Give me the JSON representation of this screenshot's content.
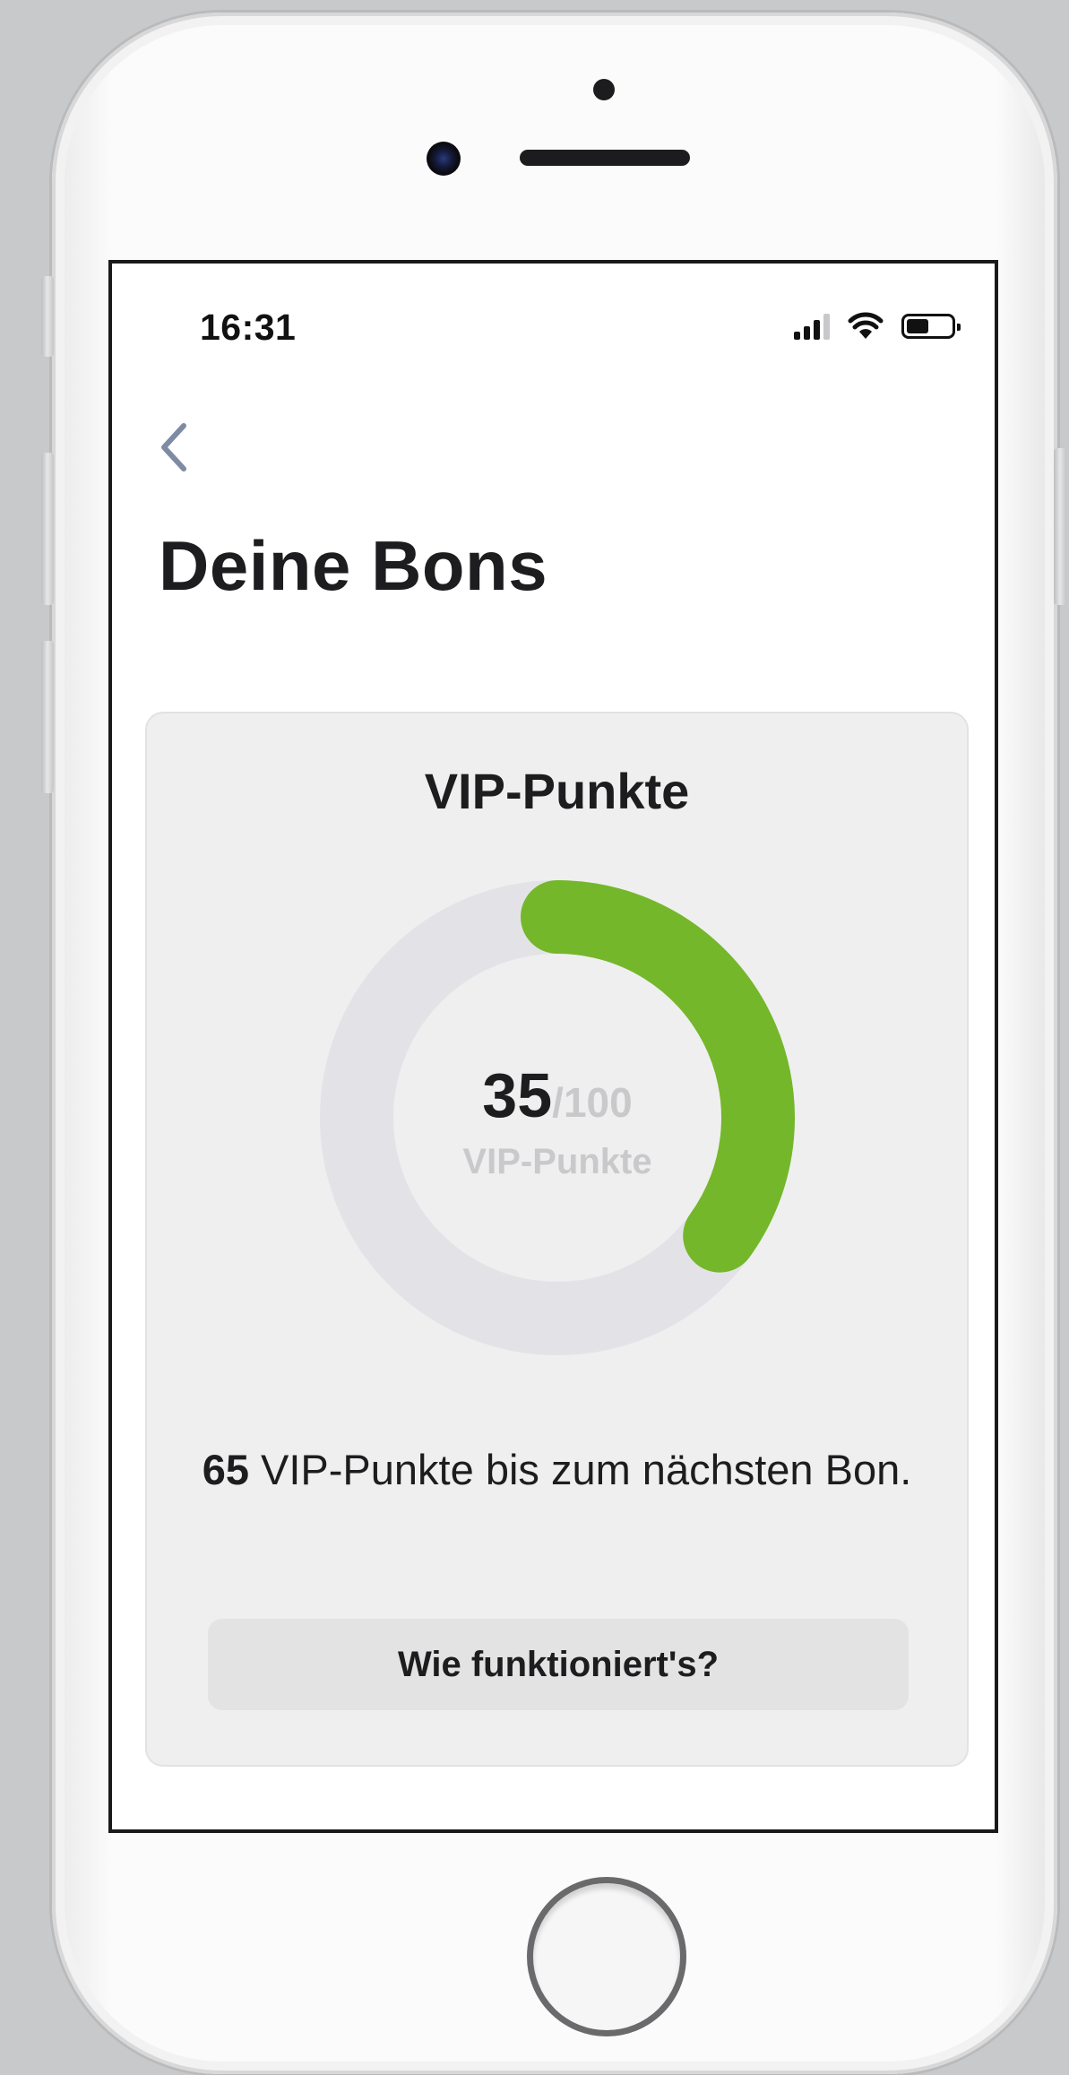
{
  "status_bar": {
    "time": "16:31",
    "icons": [
      "cellular-signal-icon",
      "wifi-icon",
      "battery-icon"
    ]
  },
  "nav": {
    "back_icon": "chevron-left-icon"
  },
  "page": {
    "title": "Deine Bons"
  },
  "vip_card": {
    "title": "VIP-Punkte",
    "current_points": "35",
    "max_points": "/100",
    "progress_fraction": 0.35,
    "gauge_unit_label": "VIP-Punkte",
    "remaining_points": "65",
    "remaining_text": " VIP-Punkte bis zum nächsten Bon.",
    "how_it_works_label": "Wie funktioniert's?"
  },
  "colors": {
    "progress": "#74b72a",
    "track": "#e3e3e7",
    "card_bg": "#efefef"
  }
}
